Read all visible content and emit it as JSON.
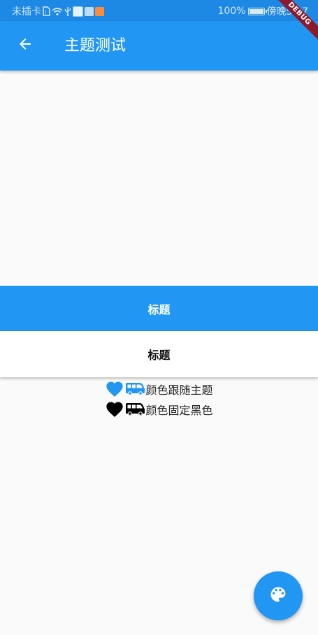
{
  "status_bar": {
    "carrier": "未插卡",
    "battery": "100%",
    "time": "傍晚5:27"
  },
  "app_bar": {
    "title": "主题测试"
  },
  "debug_banner": {
    "label": "DEBUG"
  },
  "title_bars": [
    {
      "label": "标题"
    },
    {
      "label": "标题"
    }
  ],
  "icon_rows": [
    {
      "label": "颜色跟随主题",
      "icon_color": "#2196F3",
      "icons": [
        "heart-icon",
        "bus-icon"
      ]
    },
    {
      "label": "颜色固定黑色",
      "icon_color": "#000000",
      "icons": [
        "heart-icon",
        "bus-icon"
      ]
    }
  ],
  "fab": {
    "icon": "palette-icon"
  },
  "colors": {
    "primary": "#2196F3",
    "primary_dark": "#1E88E5",
    "background": "#FAFAFA",
    "debug": "#8B1A2C"
  }
}
